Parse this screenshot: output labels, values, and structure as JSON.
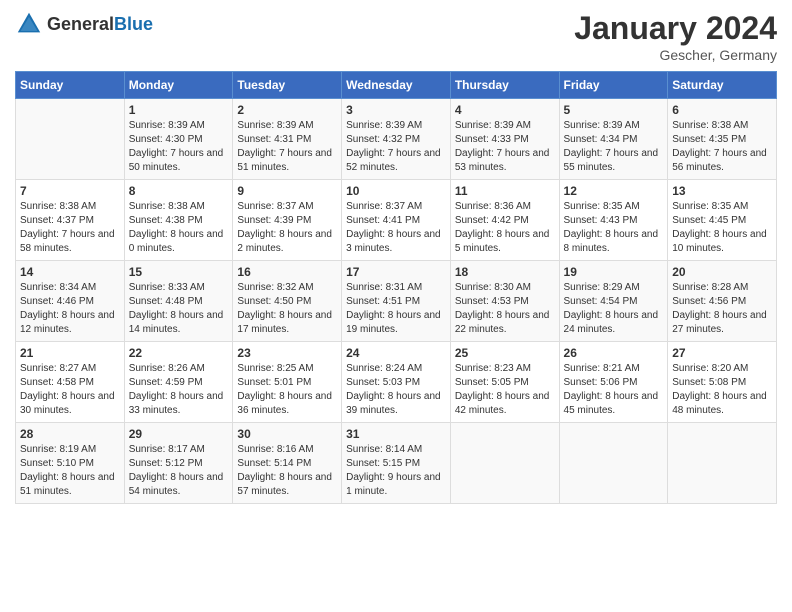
{
  "header": {
    "logo_general": "General",
    "logo_blue": "Blue",
    "month_title": "January 2024",
    "subtitle": "Gescher, Germany"
  },
  "days_of_week": [
    "Sunday",
    "Monday",
    "Tuesday",
    "Wednesday",
    "Thursday",
    "Friday",
    "Saturday"
  ],
  "weeks": [
    [
      {
        "day": "",
        "sunrise": "",
        "sunset": "",
        "daylight": ""
      },
      {
        "day": "1",
        "sunrise": "Sunrise: 8:39 AM",
        "sunset": "Sunset: 4:30 PM",
        "daylight": "Daylight: 7 hours and 50 minutes."
      },
      {
        "day": "2",
        "sunrise": "Sunrise: 8:39 AM",
        "sunset": "Sunset: 4:31 PM",
        "daylight": "Daylight: 7 hours and 51 minutes."
      },
      {
        "day": "3",
        "sunrise": "Sunrise: 8:39 AM",
        "sunset": "Sunset: 4:32 PM",
        "daylight": "Daylight: 7 hours and 52 minutes."
      },
      {
        "day": "4",
        "sunrise": "Sunrise: 8:39 AM",
        "sunset": "Sunset: 4:33 PM",
        "daylight": "Daylight: 7 hours and 53 minutes."
      },
      {
        "day": "5",
        "sunrise": "Sunrise: 8:39 AM",
        "sunset": "Sunset: 4:34 PM",
        "daylight": "Daylight: 7 hours and 55 minutes."
      },
      {
        "day": "6",
        "sunrise": "Sunrise: 8:38 AM",
        "sunset": "Sunset: 4:35 PM",
        "daylight": "Daylight: 7 hours and 56 minutes."
      }
    ],
    [
      {
        "day": "7",
        "sunrise": "Sunrise: 8:38 AM",
        "sunset": "Sunset: 4:37 PM",
        "daylight": "Daylight: 7 hours and 58 minutes."
      },
      {
        "day": "8",
        "sunrise": "Sunrise: 8:38 AM",
        "sunset": "Sunset: 4:38 PM",
        "daylight": "Daylight: 8 hours and 0 minutes."
      },
      {
        "day": "9",
        "sunrise": "Sunrise: 8:37 AM",
        "sunset": "Sunset: 4:39 PM",
        "daylight": "Daylight: 8 hours and 2 minutes."
      },
      {
        "day": "10",
        "sunrise": "Sunrise: 8:37 AM",
        "sunset": "Sunset: 4:41 PM",
        "daylight": "Daylight: 8 hours and 3 minutes."
      },
      {
        "day": "11",
        "sunrise": "Sunrise: 8:36 AM",
        "sunset": "Sunset: 4:42 PM",
        "daylight": "Daylight: 8 hours and 5 minutes."
      },
      {
        "day": "12",
        "sunrise": "Sunrise: 8:35 AM",
        "sunset": "Sunset: 4:43 PM",
        "daylight": "Daylight: 8 hours and 8 minutes."
      },
      {
        "day": "13",
        "sunrise": "Sunrise: 8:35 AM",
        "sunset": "Sunset: 4:45 PM",
        "daylight": "Daylight: 8 hours and 10 minutes."
      }
    ],
    [
      {
        "day": "14",
        "sunrise": "Sunrise: 8:34 AM",
        "sunset": "Sunset: 4:46 PM",
        "daylight": "Daylight: 8 hours and 12 minutes."
      },
      {
        "day": "15",
        "sunrise": "Sunrise: 8:33 AM",
        "sunset": "Sunset: 4:48 PM",
        "daylight": "Daylight: 8 hours and 14 minutes."
      },
      {
        "day": "16",
        "sunrise": "Sunrise: 8:32 AM",
        "sunset": "Sunset: 4:50 PM",
        "daylight": "Daylight: 8 hours and 17 minutes."
      },
      {
        "day": "17",
        "sunrise": "Sunrise: 8:31 AM",
        "sunset": "Sunset: 4:51 PM",
        "daylight": "Daylight: 8 hours and 19 minutes."
      },
      {
        "day": "18",
        "sunrise": "Sunrise: 8:30 AM",
        "sunset": "Sunset: 4:53 PM",
        "daylight": "Daylight: 8 hours and 22 minutes."
      },
      {
        "day": "19",
        "sunrise": "Sunrise: 8:29 AM",
        "sunset": "Sunset: 4:54 PM",
        "daylight": "Daylight: 8 hours and 24 minutes."
      },
      {
        "day": "20",
        "sunrise": "Sunrise: 8:28 AM",
        "sunset": "Sunset: 4:56 PM",
        "daylight": "Daylight: 8 hours and 27 minutes."
      }
    ],
    [
      {
        "day": "21",
        "sunrise": "Sunrise: 8:27 AM",
        "sunset": "Sunset: 4:58 PM",
        "daylight": "Daylight: 8 hours and 30 minutes."
      },
      {
        "day": "22",
        "sunrise": "Sunrise: 8:26 AM",
        "sunset": "Sunset: 4:59 PM",
        "daylight": "Daylight: 8 hours and 33 minutes."
      },
      {
        "day": "23",
        "sunrise": "Sunrise: 8:25 AM",
        "sunset": "Sunset: 5:01 PM",
        "daylight": "Daylight: 8 hours and 36 minutes."
      },
      {
        "day": "24",
        "sunrise": "Sunrise: 8:24 AM",
        "sunset": "Sunset: 5:03 PM",
        "daylight": "Daylight: 8 hours and 39 minutes."
      },
      {
        "day": "25",
        "sunrise": "Sunrise: 8:23 AM",
        "sunset": "Sunset: 5:05 PM",
        "daylight": "Daylight: 8 hours and 42 minutes."
      },
      {
        "day": "26",
        "sunrise": "Sunrise: 8:21 AM",
        "sunset": "Sunset: 5:06 PM",
        "daylight": "Daylight: 8 hours and 45 minutes."
      },
      {
        "day": "27",
        "sunrise": "Sunrise: 8:20 AM",
        "sunset": "Sunset: 5:08 PM",
        "daylight": "Daylight: 8 hours and 48 minutes."
      }
    ],
    [
      {
        "day": "28",
        "sunrise": "Sunrise: 8:19 AM",
        "sunset": "Sunset: 5:10 PM",
        "daylight": "Daylight: 8 hours and 51 minutes."
      },
      {
        "day": "29",
        "sunrise": "Sunrise: 8:17 AM",
        "sunset": "Sunset: 5:12 PM",
        "daylight": "Daylight: 8 hours and 54 minutes."
      },
      {
        "day": "30",
        "sunrise": "Sunrise: 8:16 AM",
        "sunset": "Sunset: 5:14 PM",
        "daylight": "Daylight: 8 hours and 57 minutes."
      },
      {
        "day": "31",
        "sunrise": "Sunrise: 8:14 AM",
        "sunset": "Sunset: 5:15 PM",
        "daylight": "Daylight: 9 hours and 1 minute."
      },
      {
        "day": "",
        "sunrise": "",
        "sunset": "",
        "daylight": ""
      },
      {
        "day": "",
        "sunrise": "",
        "sunset": "",
        "daylight": ""
      },
      {
        "day": "",
        "sunrise": "",
        "sunset": "",
        "daylight": ""
      }
    ]
  ]
}
